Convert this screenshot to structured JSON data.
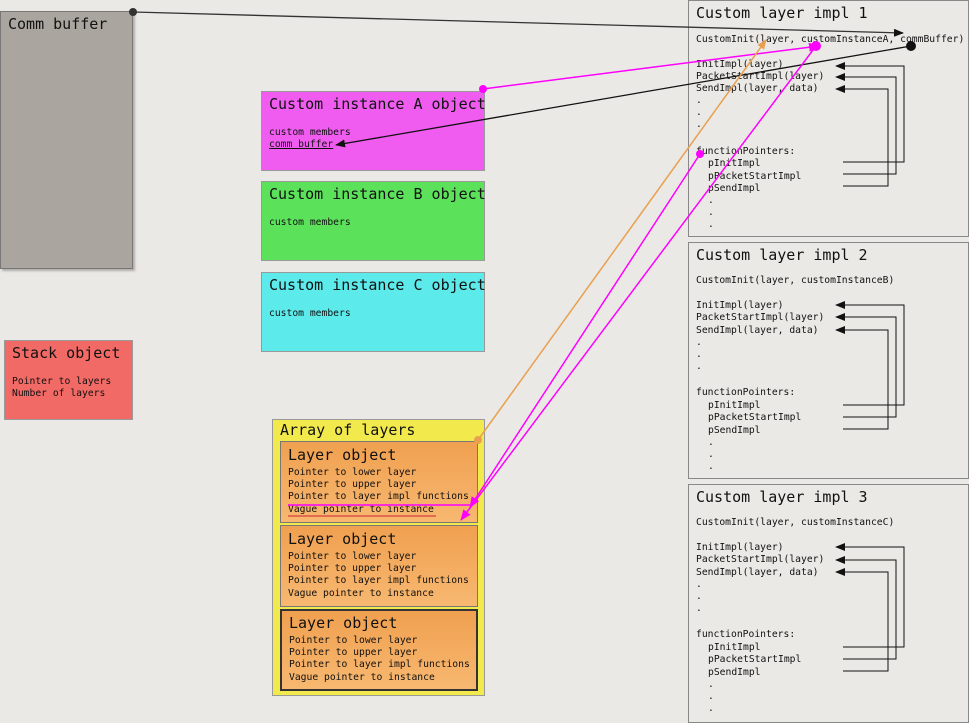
{
  "comm_buffer": {
    "title": "Comm buffer"
  },
  "instance_a": {
    "title": "Custom instance A object",
    "members": "custom members",
    "comm_buffer": "comm buffer"
  },
  "instance_b": {
    "title": "Custom instance B object",
    "members": "custom members"
  },
  "instance_c": {
    "title": "Custom instance C object",
    "members": "custom members"
  },
  "stack": {
    "title": "Stack object",
    "lines": [
      "Pointer to layers",
      "Number of layers"
    ]
  },
  "array": {
    "title": "Array of layers",
    "layers": [
      {
        "title": "Layer object",
        "lines": [
          "Pointer to lower layer",
          "Pointer to upper layer",
          "Pointer to layer impl functions",
          "Vague pointer to instance"
        ]
      },
      {
        "title": "Layer object",
        "lines": [
          "Pointer to lower layer",
          "Pointer to upper layer",
          "Pointer to layer impl functions",
          "Vague pointer to instance"
        ]
      },
      {
        "title": "Layer object",
        "lines": [
          "Pointer to lower layer",
          "Pointer to upper layer",
          "Pointer to layer impl functions",
          "Vague pointer to instance"
        ]
      }
    ]
  },
  "impls": [
    {
      "title": "Custom layer impl 1",
      "init_call": "CustomInit(layer, customInstanceA, commBuffer)",
      "functions": [
        "InitImpl(layer)",
        "PacketStartImpl(layer)",
        "SendImpl(layer, data)"
      ],
      "fp_label": "functionPointers:",
      "pointers": [
        "pInitImpl",
        "pPacketStartImpl",
        "pSendImpl"
      ],
      "dot": "."
    },
    {
      "title": "Custom layer impl 2",
      "init_call": "CustomInit(layer, customInstanceB)",
      "functions": [
        "InitImpl(layer)",
        "PacketStartImpl(layer)",
        "SendImpl(layer, data)"
      ],
      "fp_label": "functionPointers:",
      "pointers": [
        "pInitImpl",
        "pPacketStartImpl",
        "pSendImpl"
      ],
      "dot": "."
    },
    {
      "title": "Custom layer impl 3",
      "init_call": "CustomInit(layer, customInstanceC)",
      "functions": [
        "InitImpl(layer)",
        "PacketStartImpl(layer)",
        "SendImpl(layer, data)"
      ],
      "fp_label": "functionPointers:",
      "pointers": [
        "pInitImpl",
        "pPacketStartImpl",
        "pSendImpl"
      ],
      "dot": "."
    }
  ],
  "colors": {
    "comm_buffer": "#aaa69f",
    "instance_a": "#f05cf0",
    "instance_b": "#5ce25a",
    "instance_c": "#5ceaea",
    "stack": "#f26a66",
    "array": "#f2ea4c",
    "layer": "#f0a050",
    "magenta_arrow": "#ff00ff",
    "orange_arrow": "#e8a050",
    "black_arrow": "#111111"
  }
}
